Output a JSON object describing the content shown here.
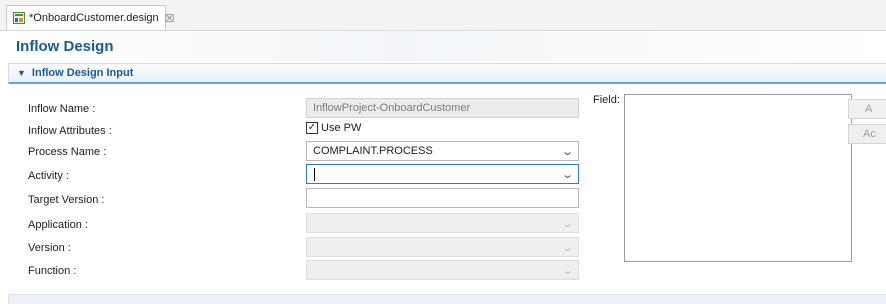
{
  "tab": {
    "label": "*OnboardCustomer.design",
    "close": "☒"
  },
  "header": {
    "title": "Inflow Design"
  },
  "section": {
    "title": "Inflow Design Input"
  },
  "form": {
    "inflow_name_label": "Inflow Name :",
    "inflow_name_value": "InflowProject-OnboardCustomer",
    "inflow_attributes_label": "Inflow Attributes :",
    "use_pw_label": "Use PW",
    "use_pw_checked": true,
    "process_name_label": "Process Name :",
    "process_name_value": "COMPLAINT.PROCESS",
    "activity_label": "Activity :",
    "activity_value": "",
    "target_version_label": "Target Version :",
    "target_version_value": "",
    "application_label": "Application :",
    "version_label": "Version :",
    "function_label": "Function :"
  },
  "field_panel": {
    "label": "Field:"
  },
  "side_buttons": {
    "first": "A",
    "second": "Ac"
  },
  "icons": {
    "editor_icon": "editor-icon",
    "dropdown": "chevron-down-icon"
  },
  "colors": {
    "accent": "#1b5a8f",
    "section_border": "#6fa3d8",
    "focus_border": "#2f7ad0"
  }
}
